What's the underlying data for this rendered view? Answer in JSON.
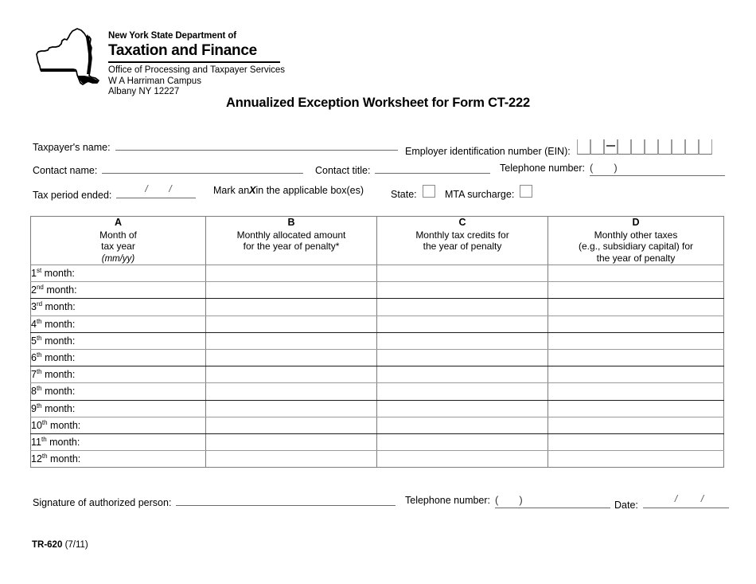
{
  "agency": {
    "logo_icon": "new-york-state-outline-icon",
    "line1": "New York State Department of",
    "line2": "Taxation and Finance",
    "office": "Office of Processing and Taxpayer Services",
    "campus": "W A Harriman Campus",
    "city_state_zip": "Albany NY 12227"
  },
  "title": "Annualized Exception Worksheet for Form CT-222",
  "fields": {
    "taxpayer_name_label": "Taxpayer's name:",
    "ein_label": "Employer identification number (EIN):",
    "ein_cells": 9,
    "ein_dash_after": 2,
    "contact_name_label": "Contact name:",
    "contact_title_label": "Contact title:",
    "telephone_label": "Telephone number:",
    "telephone_open_paren": "(",
    "telephone_close_paren": ")",
    "tax_period_label": "Tax period ended:",
    "date_slash": "/",
    "mark_x_prefix": "Mark an ",
    "mark_x_letter": "X",
    "mark_x_suffix": " in the applicable box(es)",
    "state_label": "State:",
    "mta_label": "MTA surcharge:"
  },
  "table": {
    "columns": [
      {
        "letter": "A",
        "lines": [
          "Month of",
          "tax year"
        ],
        "italic_line": "(mm/yy)"
      },
      {
        "letter": "B",
        "lines": [
          "Monthly allocated amount",
          "for the year of penalty*"
        ],
        "italic_line": ""
      },
      {
        "letter": "C",
        "lines": [
          "Monthly tax credits for",
          "the year of penalty"
        ],
        "italic_line": ""
      },
      {
        "letter": "D",
        "lines": [
          "Monthly other taxes",
          "(e.g., subsidiary capital) for",
          "the year of penalty"
        ],
        "italic_line": ""
      }
    ],
    "rows": [
      {
        "num": "1",
        "ord": "st",
        "label_suffix": " month:",
        "b": "",
        "c": "",
        "d": ""
      },
      {
        "num": "2",
        "ord": "nd",
        "label_suffix": " month:",
        "b": "",
        "c": "",
        "d": ""
      },
      {
        "num": "3",
        "ord": "rd",
        "label_suffix": " month:",
        "b": "",
        "c": "",
        "d": ""
      },
      {
        "num": "4",
        "ord": "th",
        "label_suffix": " month:",
        "b": "",
        "c": "",
        "d": ""
      },
      {
        "num": "5",
        "ord": "th",
        "label_suffix": " month:",
        "b": "",
        "c": "",
        "d": ""
      },
      {
        "num": "6",
        "ord": "th",
        "label_suffix": " month:",
        "b": "",
        "c": "",
        "d": ""
      },
      {
        "num": "7",
        "ord": "th",
        "label_suffix": " month:",
        "b": "",
        "c": "",
        "d": ""
      },
      {
        "num": "8",
        "ord": "th",
        "label_suffix": " month:",
        "b": "",
        "c": "",
        "d": ""
      },
      {
        "num": "9",
        "ord": "th",
        "label_suffix": " month:",
        "b": "",
        "c": "",
        "d": ""
      },
      {
        "num": "10",
        "ord": "th",
        "label_suffix": " month:",
        "b": "",
        "c": "",
        "d": ""
      },
      {
        "num": "11",
        "ord": "th",
        "label_suffix": " month:",
        "b": "",
        "c": "",
        "d": ""
      },
      {
        "num": "12",
        "ord": "th",
        "label_suffix": " month:",
        "b": "",
        "c": "",
        "d": ""
      }
    ]
  },
  "signature": {
    "signature_label": "Signature of authorized person:",
    "telephone_label": "Telephone number:",
    "date_label": "Date:"
  },
  "footer": {
    "code": "TR-620",
    "revision": "(7/11)"
  }
}
